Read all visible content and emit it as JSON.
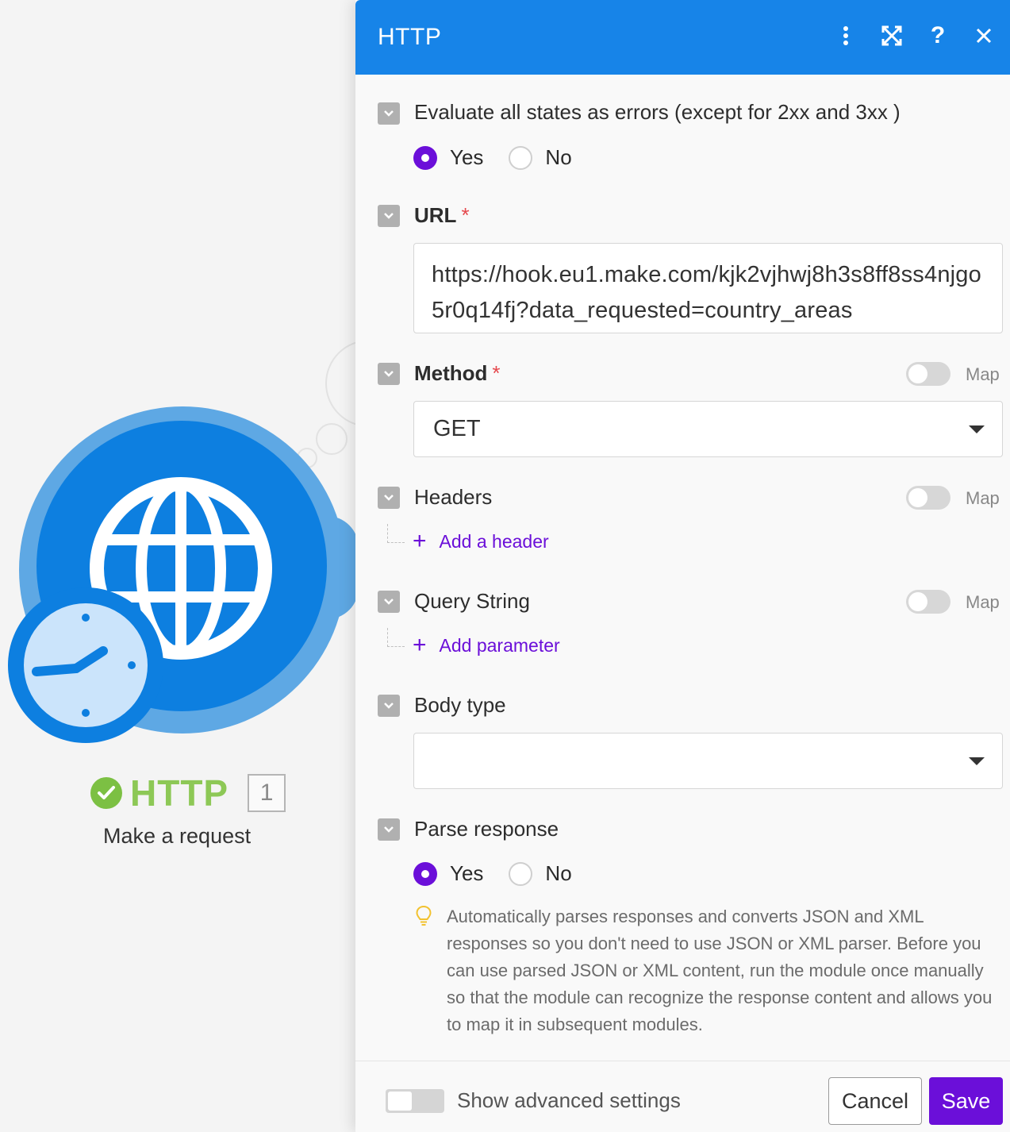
{
  "module": {
    "name": "HTTP",
    "number": "1",
    "subtitle": "Make a request"
  },
  "panel": {
    "title": "HTTP",
    "header_icons": [
      "more-vertical-icon",
      "expand-icon",
      "help-icon",
      "close-icon"
    ],
    "accent_color": "#1784e8"
  },
  "fields": {
    "evaluate": {
      "label": "Evaluate all states as errors (except for 2xx and 3xx )",
      "yes": "Yes",
      "no": "No",
      "selected": "Yes"
    },
    "url": {
      "label": "URL",
      "required": "*",
      "value": "https://hook.eu1.make.com/kjk2vjhwj8h3s8ff8ss4njgo5r0q14fj?data_requested=country_areas"
    },
    "method": {
      "label": "Method",
      "required": "*",
      "map_label": "Map",
      "value": "GET"
    },
    "headers": {
      "label": "Headers",
      "map_label": "Map",
      "add_label": "Add a header"
    },
    "query": {
      "label": "Query String",
      "map_label": "Map",
      "add_label": "Add parameter"
    },
    "body_type": {
      "label": "Body type",
      "value": ""
    },
    "parse": {
      "label": "Parse response",
      "yes": "Yes",
      "no": "No",
      "selected": "Yes",
      "hint": "Automatically parses responses and converts JSON and XML responses so you don't need to use JSON or XML parser. Before you can use parsed JSON or XML content, run the module once manually so that the module can recognize the response content and allows you to map it in subsequent modules."
    }
  },
  "footer": {
    "advanced_label": "Show advanced settings",
    "cancel_label": "Cancel",
    "save_label": "Save",
    "save_color": "#6b0fd9"
  }
}
